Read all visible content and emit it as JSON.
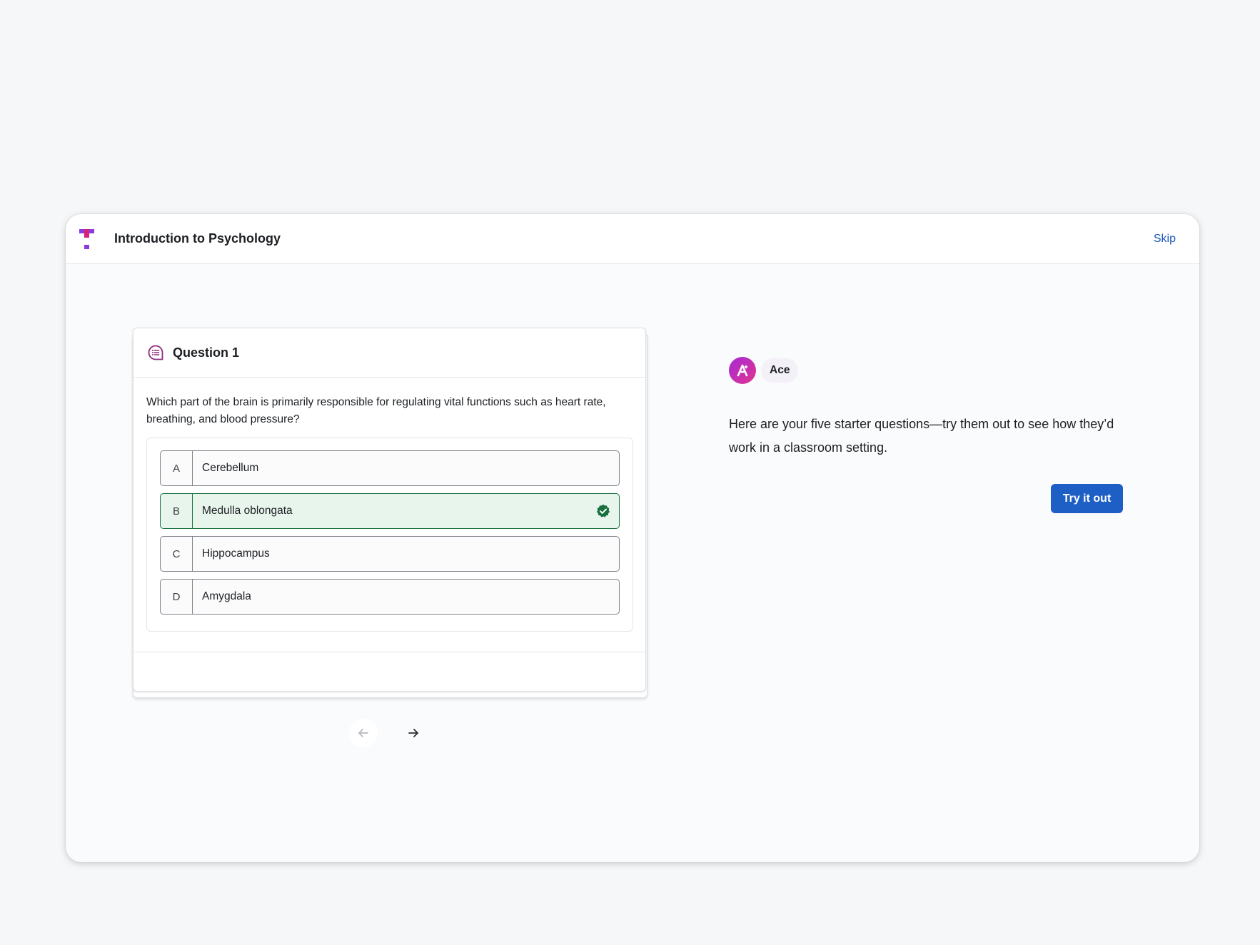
{
  "header": {
    "title": "Introduction to Psychology",
    "skip_label": "Skip",
    "logo_icon": "brand-logo-icon"
  },
  "question": {
    "title": "Question 1",
    "icon": "chat-list-icon",
    "text": "Which part of the brain is primarily responsible for regulating vital functions such as heart rate, breathing, and blood pressure?",
    "options": [
      {
        "letter": "A",
        "label": "Cerebellum",
        "correct": false
      },
      {
        "letter": "B",
        "label": "Medulla oblongata",
        "correct": true
      },
      {
        "letter": "C",
        "label": "Hippocampus",
        "correct": false
      },
      {
        "letter": "D",
        "label": "Amygdala",
        "correct": false
      }
    ]
  },
  "navigation": {
    "prev_icon": "arrow-left-icon",
    "next_icon": "arrow-right-icon",
    "prev_enabled": false,
    "next_enabled": true
  },
  "assistant": {
    "name": "Ace",
    "avatar_icon": "ace-avatar-icon",
    "message": "Here are your five starter questions—try them out to see how they’d work in a classroom setting.",
    "button_label": "Try it out"
  },
  "colors": {
    "accent": "#1d5fc4",
    "correct": "#17703e",
    "correct_bg": "#e8f5ec",
    "brand_magenta": "#d4237a",
    "brand_purple": "#8a3ae0"
  }
}
